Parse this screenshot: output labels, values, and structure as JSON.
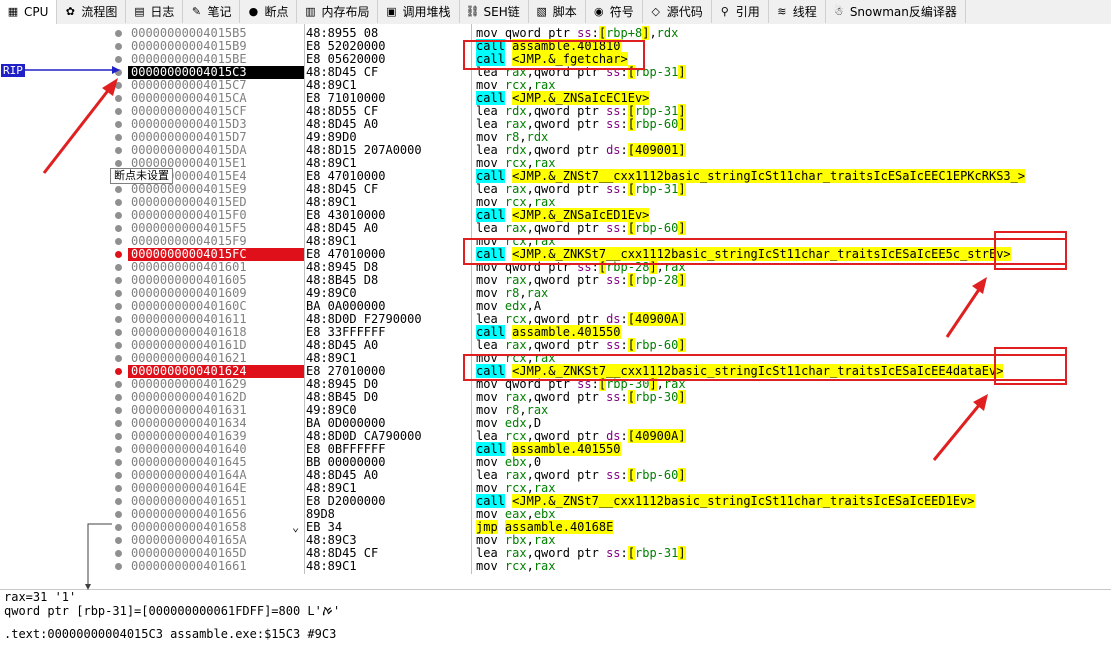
{
  "tabs": [
    {
      "label": "CPU",
      "icon": "cpu-icon",
      "glyph": "▦",
      "active": true
    },
    {
      "label": "流程图",
      "icon": "graph-icon",
      "glyph": "✿"
    },
    {
      "label": "日志",
      "icon": "log-icon",
      "glyph": "▤"
    },
    {
      "label": "笔记",
      "icon": "notes-icon",
      "glyph": "✎"
    },
    {
      "label": "断点",
      "icon": "breakpoint-icon",
      "glyph": "●"
    },
    {
      "label": "内存布局",
      "icon": "memory-map-icon",
      "glyph": "▥"
    },
    {
      "label": "调用堆栈",
      "icon": "call-stack-icon",
      "glyph": "▣"
    },
    {
      "label": "SEH链",
      "icon": "seh-icon",
      "glyph": "⛓"
    },
    {
      "label": "脚本",
      "icon": "script-icon",
      "glyph": "▧"
    },
    {
      "label": "符号",
      "icon": "symbols-icon",
      "glyph": "◉"
    },
    {
      "label": "源代码",
      "icon": "source-icon",
      "glyph": "◇"
    },
    {
      "label": "引用",
      "icon": "references-icon",
      "glyph": "⚲"
    },
    {
      "label": "线程",
      "icon": "threads-icon",
      "glyph": "≋"
    },
    {
      "label": "Snowman反编译器",
      "icon": "snowman-icon",
      "glyph": "☃"
    }
  ],
  "rip_label": "RIP",
  "tooltip": "断点未设置",
  "rows": [
    {
      "addr": "00000000004015B5",
      "bytes": "48:8955 08",
      "instr": [
        {
          "t": "mov qword ptr "
        },
        {
          "t": "ss",
          "c": "seg"
        },
        {
          "t": ":"
        },
        {
          "t": "[",
          "c": "brk"
        },
        {
          "t": "rbp+8",
          "c": "reg"
        },
        {
          "t": "]",
          "c": "brk"
        },
        {
          "t": ","
        },
        {
          "t": "rdx",
          "c": "reg"
        }
      ]
    },
    {
      "addr": "00000000004015B9",
      "bytes": "E8 52020000",
      "instr": [
        {
          "t": "call",
          "c": "mn-call"
        },
        {
          "t": " "
        },
        {
          "t": "assamble.401810",
          "c": "hl-tgt"
        }
      ]
    },
    {
      "addr": "00000000004015BE",
      "bytes": "E8 05620000",
      "instr": [
        {
          "t": "call",
          "c": "mn-call"
        },
        {
          "t": " "
        },
        {
          "t": "<JMP.&_fgetchar>",
          "c": "hl-tgt"
        }
      ]
    },
    {
      "addr": "00000000004015C3",
      "bytes": "48:8D45 CF",
      "state": "rip",
      "instr": [
        {
          "t": "lea "
        },
        {
          "t": "rax",
          "c": "reg"
        },
        {
          "t": ",qword ptr "
        },
        {
          "t": "ss",
          "c": "seg"
        },
        {
          "t": ":"
        },
        {
          "t": "[",
          "c": "brk"
        },
        {
          "t": "rbp-31",
          "c": "reg"
        },
        {
          "t": "]",
          "c": "brk"
        }
      ]
    },
    {
      "addr": "00000000004015C7",
      "bytes": "48:89C1",
      "instr": [
        {
          "t": "mov "
        },
        {
          "t": "rcx",
          "c": "reg"
        },
        {
          "t": ","
        },
        {
          "t": "rax",
          "c": "reg"
        }
      ]
    },
    {
      "addr": "00000000004015CA",
      "bytes": "E8 71010000",
      "instr": [
        {
          "t": "call",
          "c": "mn-call"
        },
        {
          "t": " "
        },
        {
          "t": "<JMP.&_ZNSaIcEC1Ev>",
          "c": "hl-tgt"
        }
      ]
    },
    {
      "addr": "00000000004015CF",
      "bytes": "48:8D55 CF",
      "instr": [
        {
          "t": "lea "
        },
        {
          "t": "rdx",
          "c": "reg"
        },
        {
          "t": ",qword ptr "
        },
        {
          "t": "ss",
          "c": "seg"
        },
        {
          "t": ":"
        },
        {
          "t": "[",
          "c": "brk"
        },
        {
          "t": "rbp-31",
          "c": "reg"
        },
        {
          "t": "]",
          "c": "brk"
        }
      ]
    },
    {
      "addr": "00000000004015D3",
      "bytes": "48:8D45 A0",
      "instr": [
        {
          "t": "lea "
        },
        {
          "t": "rax",
          "c": "reg"
        },
        {
          "t": ",qword ptr "
        },
        {
          "t": "ss",
          "c": "seg"
        },
        {
          "t": ":"
        },
        {
          "t": "[",
          "c": "brk"
        },
        {
          "t": "rbp-60",
          "c": "reg"
        },
        {
          "t": "]",
          "c": "brk"
        }
      ]
    },
    {
      "addr": "00000000004015D7",
      "bytes": "49:89D0",
      "instr": [
        {
          "t": "mov "
        },
        {
          "t": "r8",
          "c": "reg"
        },
        {
          "t": ","
        },
        {
          "t": "rdx",
          "c": "reg"
        }
      ]
    },
    {
      "addr": "00000000004015DA",
      "bytes": "48:8D15 207A0000",
      "instr": [
        {
          "t": "lea "
        },
        {
          "t": "rdx",
          "c": "reg"
        },
        {
          "t": ",qword ptr "
        },
        {
          "t": "ds",
          "c": "seg"
        },
        {
          "t": ":"
        },
        {
          "t": "[",
          "c": "brk"
        },
        {
          "t": "409001",
          "c": "brk"
        },
        {
          "t": "]",
          "c": "brk"
        }
      ]
    },
    {
      "addr": "00000000004015E1",
      "bytes": "48:89C1",
      "instr": [
        {
          "t": "mov "
        },
        {
          "t": "rcx",
          "c": "reg"
        },
        {
          "t": ","
        },
        {
          "t": "rax",
          "c": "reg"
        }
      ]
    },
    {
      "addr": "00000000004015E4",
      "bytes": "E8 47010000",
      "instr": [
        {
          "t": "call",
          "c": "mn-call"
        },
        {
          "t": " "
        },
        {
          "t": "<JMP.&_ZNSt7__cxx1112basic_stringIcSt11char_traitsIcESaIcEEC1EPKcRKS3_>",
          "c": "hl-tgt"
        }
      ]
    },
    {
      "addr": "00000000004015E9",
      "bytes": "48:8D45 CF",
      "instr": [
        {
          "t": "lea "
        },
        {
          "t": "rax",
          "c": "reg"
        },
        {
          "t": ",qword ptr "
        },
        {
          "t": "ss",
          "c": "seg"
        },
        {
          "t": ":"
        },
        {
          "t": "[",
          "c": "brk"
        },
        {
          "t": "rbp-31",
          "c": "reg"
        },
        {
          "t": "]",
          "c": "brk"
        }
      ]
    },
    {
      "addr": "00000000004015ED",
      "bytes": "48:89C1",
      "instr": [
        {
          "t": "mov "
        },
        {
          "t": "rcx",
          "c": "reg"
        },
        {
          "t": ","
        },
        {
          "t": "rax",
          "c": "reg"
        }
      ]
    },
    {
      "addr": "00000000004015F0",
      "bytes": "E8 43010000",
      "instr": [
        {
          "t": "call",
          "c": "mn-call"
        },
        {
          "t": " "
        },
        {
          "t": "<JMP.&_ZNSaIcED1Ev>",
          "c": "hl-tgt"
        }
      ]
    },
    {
      "addr": "00000000004015F5",
      "bytes": "48:8D45 A0",
      "instr": [
        {
          "t": "lea "
        },
        {
          "t": "rax",
          "c": "reg"
        },
        {
          "t": ",qword ptr "
        },
        {
          "t": "ss",
          "c": "seg"
        },
        {
          "t": ":"
        },
        {
          "t": "[",
          "c": "brk"
        },
        {
          "t": "rbp-60",
          "c": "reg"
        },
        {
          "t": "]",
          "c": "brk"
        }
      ]
    },
    {
      "addr": "00000000004015F9",
      "bytes": "48:89C1",
      "instr": [
        {
          "t": "mov "
        },
        {
          "t": "rcx",
          "c": "reg"
        },
        {
          "t": ","
        },
        {
          "t": "rax",
          "c": "reg"
        }
      ]
    },
    {
      "addr": "00000000004015FC",
      "bytes": "E8 47010000",
      "state": "bp",
      "instr": [
        {
          "t": "call",
          "c": "mn-call"
        },
        {
          "t": " "
        },
        {
          "t": "<JMP.&_ZNKSt7__cxx1112basic_stringIcSt11char_traitsIcESaIcEE5c_strEv>",
          "c": "hl-tgt"
        }
      ]
    },
    {
      "addr": "0000000000401601",
      "bytes": "48:8945 D8",
      "instr": [
        {
          "t": "mov qword ptr "
        },
        {
          "t": "ss",
          "c": "seg"
        },
        {
          "t": ":"
        },
        {
          "t": "[",
          "c": "brk"
        },
        {
          "t": "rbp-28",
          "c": "reg"
        },
        {
          "t": "]",
          "c": "brk"
        },
        {
          "t": ","
        },
        {
          "t": "rax",
          "c": "reg"
        }
      ]
    },
    {
      "addr": "0000000000401605",
      "bytes": "48:8B45 D8",
      "instr": [
        {
          "t": "mov "
        },
        {
          "t": "rax",
          "c": "reg"
        },
        {
          "t": ",qword ptr "
        },
        {
          "t": "ss",
          "c": "seg"
        },
        {
          "t": ":"
        },
        {
          "t": "[",
          "c": "brk"
        },
        {
          "t": "rbp-28",
          "c": "reg"
        },
        {
          "t": "]",
          "c": "brk"
        }
      ]
    },
    {
      "addr": "0000000000401609",
      "bytes": "49:89C0",
      "instr": [
        {
          "t": "mov "
        },
        {
          "t": "r8",
          "c": "reg"
        },
        {
          "t": ","
        },
        {
          "t": "rax",
          "c": "reg"
        }
      ]
    },
    {
      "addr": "000000000040160C",
      "bytes": "BA 0A000000",
      "instr": [
        {
          "t": "mov "
        },
        {
          "t": "edx",
          "c": "reg"
        },
        {
          "t": ",A"
        }
      ]
    },
    {
      "addr": "0000000000401611",
      "bytes": "48:8D0D F2790000",
      "instr": [
        {
          "t": "lea "
        },
        {
          "t": "rcx",
          "c": "reg"
        },
        {
          "t": ",qword ptr "
        },
        {
          "t": "ds",
          "c": "seg"
        },
        {
          "t": ":"
        },
        {
          "t": "[",
          "c": "brk"
        },
        {
          "t": "40900A",
          "c": "brk"
        },
        {
          "t": "]",
          "c": "brk"
        }
      ]
    },
    {
      "addr": "0000000000401618",
      "bytes": "E8 33FFFFFF",
      "instr": [
        {
          "t": "call",
          "c": "mn-call"
        },
        {
          "t": " "
        },
        {
          "t": "assamble.401550",
          "c": "hl-tgt"
        }
      ]
    },
    {
      "addr": "000000000040161D",
      "bytes": "48:8D45 A0",
      "instr": [
        {
          "t": "lea "
        },
        {
          "t": "rax",
          "c": "reg"
        },
        {
          "t": ",qword ptr "
        },
        {
          "t": "ss",
          "c": "seg"
        },
        {
          "t": ":"
        },
        {
          "t": "[",
          "c": "brk"
        },
        {
          "t": "rbp-60",
          "c": "reg"
        },
        {
          "t": "]",
          "c": "brk"
        }
      ]
    },
    {
      "addr": "0000000000401621",
      "bytes": "48:89C1",
      "instr": [
        {
          "t": "mov "
        },
        {
          "t": "rcx",
          "c": "reg"
        },
        {
          "t": ","
        },
        {
          "t": "rax",
          "c": "reg"
        }
      ]
    },
    {
      "addr": "0000000000401624",
      "bytes": "E8 27010000",
      "state": "bp",
      "instr": [
        {
          "t": "call",
          "c": "mn-call"
        },
        {
          "t": " "
        },
        {
          "t": "<JMP.&_ZNKSt7__cxx1112basic_stringIcSt11char_traitsIcESaIcEE4dataEv>",
          "c": "hl-tgt"
        }
      ]
    },
    {
      "addr": "0000000000401629",
      "bytes": "48:8945 D0",
      "instr": [
        {
          "t": "mov qword ptr "
        },
        {
          "t": "ss",
          "c": "seg"
        },
        {
          "t": ":"
        },
        {
          "t": "[",
          "c": "brk"
        },
        {
          "t": "rbp-30",
          "c": "reg"
        },
        {
          "t": "]",
          "c": "brk"
        },
        {
          "t": ","
        },
        {
          "t": "rax",
          "c": "reg"
        }
      ]
    },
    {
      "addr": "000000000040162D",
      "bytes": "48:8B45 D0",
      "instr": [
        {
          "t": "mov "
        },
        {
          "t": "rax",
          "c": "reg"
        },
        {
          "t": ",qword ptr "
        },
        {
          "t": "ss",
          "c": "seg"
        },
        {
          "t": ":"
        },
        {
          "t": "[",
          "c": "brk"
        },
        {
          "t": "rbp-30",
          "c": "reg"
        },
        {
          "t": "]",
          "c": "brk"
        }
      ]
    },
    {
      "addr": "0000000000401631",
      "bytes": "49:89C0",
      "instr": [
        {
          "t": "mov "
        },
        {
          "t": "r8",
          "c": "reg"
        },
        {
          "t": ","
        },
        {
          "t": "rax",
          "c": "reg"
        }
      ]
    },
    {
      "addr": "0000000000401634",
      "bytes": "BA 0D000000",
      "instr": [
        {
          "t": "mov "
        },
        {
          "t": "edx",
          "c": "reg"
        },
        {
          "t": ",D"
        }
      ]
    },
    {
      "addr": "0000000000401639",
      "bytes": "48:8D0D CA790000",
      "instr": [
        {
          "t": "lea "
        },
        {
          "t": "rcx",
          "c": "reg"
        },
        {
          "t": ",qword ptr "
        },
        {
          "t": "ds",
          "c": "seg"
        },
        {
          "t": ":"
        },
        {
          "t": "[",
          "c": "brk"
        },
        {
          "t": "40900A",
          "c": "brk"
        },
        {
          "t": "]",
          "c": "brk"
        }
      ]
    },
    {
      "addr": "0000000000401640",
      "bytes": "E8 0BFFFFFF",
      "instr": [
        {
          "t": "call",
          "c": "mn-call"
        },
        {
          "t": " "
        },
        {
          "t": "assamble.401550",
          "c": "hl-tgt"
        }
      ]
    },
    {
      "addr": "0000000000401645",
      "bytes": "BB 00000000",
      "instr": [
        {
          "t": "mov "
        },
        {
          "t": "ebx",
          "c": "reg"
        },
        {
          "t": ",0"
        }
      ]
    },
    {
      "addr": "000000000040164A",
      "bytes": "48:8D45 A0",
      "instr": [
        {
          "t": "lea "
        },
        {
          "t": "rax",
          "c": "reg"
        },
        {
          "t": ",qword ptr "
        },
        {
          "t": "ss",
          "c": "seg"
        },
        {
          "t": ":"
        },
        {
          "t": "[",
          "c": "brk"
        },
        {
          "t": "rbp-60",
          "c": "reg"
        },
        {
          "t": "]",
          "c": "brk"
        }
      ]
    },
    {
      "addr": "000000000040164E",
      "bytes": "48:89C1",
      "instr": [
        {
          "t": "mov "
        },
        {
          "t": "rcx",
          "c": "reg"
        },
        {
          "t": ","
        },
        {
          "t": "rax",
          "c": "reg"
        }
      ]
    },
    {
      "addr": "0000000000401651",
      "bytes": "E8 D2000000",
      "instr": [
        {
          "t": "call",
          "c": "mn-call"
        },
        {
          "t": " "
        },
        {
          "t": "<JMP.&_ZNSt7__cxx1112basic_stringIcSt11char_traitsIcESaIcEED1Ev>",
          "c": "hl-tgt"
        }
      ]
    },
    {
      "addr": "0000000000401656",
      "bytes": "89D8",
      "instr": [
        {
          "t": "mov "
        },
        {
          "t": "eax",
          "c": "reg"
        },
        {
          "t": ","
        },
        {
          "t": "ebx",
          "c": "reg"
        }
      ]
    },
    {
      "addr": "0000000000401658",
      "bytes": "EB 34",
      "jmp_mark": "⌄",
      "instr": [
        {
          "t": "jmp",
          "c": "hl-jmp"
        },
        {
          "t": " "
        },
        {
          "t": "assamble.40168E",
          "c": "hl-tgt"
        }
      ]
    },
    {
      "addr": "000000000040165A",
      "bytes": "48:89C3",
      "instr": [
        {
          "t": "mov "
        },
        {
          "t": "rbx",
          "c": "reg"
        },
        {
          "t": ","
        },
        {
          "t": "rax",
          "c": "reg"
        }
      ]
    },
    {
      "addr": "000000000040165D",
      "bytes": "48:8D45 CF",
      "instr": [
        {
          "t": "lea "
        },
        {
          "t": "rax",
          "c": "reg"
        },
        {
          "t": ",qword ptr "
        },
        {
          "t": "ss",
          "c": "seg"
        },
        {
          "t": ":"
        },
        {
          "t": "[",
          "c": "brk"
        },
        {
          "t": "rbp-31",
          "c": "reg"
        },
        {
          "t": "]",
          "c": "brk"
        }
      ]
    },
    {
      "addr": "0000000000401661",
      "bytes": "48:89C1",
      "instr": [
        {
          "t": "mov "
        },
        {
          "t": "rcx",
          "c": "reg"
        },
        {
          "t": ","
        },
        {
          "t": "rax",
          "c": "reg"
        }
      ]
    }
  ],
  "info": {
    "line1": "rax=31 '1'",
    "line2": "qword ptr [rbp-31]=[000000000061FDFF]=800 L'ࠀ'",
    "line3": ".text:00000000004015C3 assamble.exe:$15C3 #9C3"
  },
  "colors": {
    "breakpoint": "#e0101a",
    "call": "#00ffff",
    "target": "#ffff00",
    "annotation": "#e02020",
    "rip_label": "#2020c8"
  }
}
